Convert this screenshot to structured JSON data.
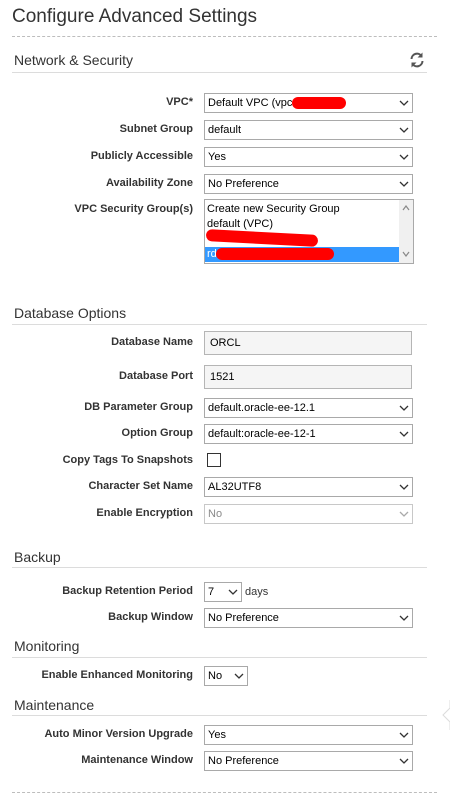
{
  "page": {
    "title": "Configure Advanced Settings"
  },
  "network": {
    "title": "Network & Security",
    "vpc": {
      "label": "VPC*",
      "value": "Default VPC (vpc-"
    },
    "subnet_group": {
      "label": "Subnet Group",
      "value": "default"
    },
    "publicly_accessible": {
      "label": "Publicly Accessible",
      "value": "Yes"
    },
    "availability_zone": {
      "label": "Availability Zone",
      "value": "No Preference"
    },
    "security_groups": {
      "label": "VPC Security Group(s)",
      "options": [
        "Create new Security Group",
        "default (VPC)",
        "",
        "rd"
      ],
      "selected_index": 3
    }
  },
  "database": {
    "title": "Database Options",
    "name": {
      "label": "Database Name",
      "value": "ORCL"
    },
    "port": {
      "label": "Database Port",
      "value": "1521"
    },
    "parameter_group": {
      "label": "DB Parameter Group",
      "value": "default.oracle-ee-12.1"
    },
    "option_group": {
      "label": "Option Group",
      "value": "default:oracle-ee-12-1"
    },
    "copy_tags": {
      "label": "Copy Tags To Snapshots",
      "checked": false
    },
    "character_set": {
      "label": "Character Set Name",
      "value": "AL32UTF8"
    },
    "encryption": {
      "label": "Enable Encryption",
      "value": "No",
      "disabled": true
    }
  },
  "backup": {
    "title": "Backup",
    "retention": {
      "label": "Backup Retention Period",
      "value": "7",
      "suffix": "days"
    },
    "window": {
      "label": "Backup Window",
      "value": "No Preference"
    }
  },
  "monitoring": {
    "title": "Monitoring",
    "enhanced": {
      "label": "Enable Enhanced Monitoring",
      "value": "No"
    }
  },
  "maintenance": {
    "title": "Maintenance",
    "auto_minor": {
      "label": "Auto Minor Version Upgrade",
      "value": "Yes"
    },
    "window": {
      "label": "Maintenance Window",
      "value": "No Preference"
    }
  },
  "icons": {
    "refresh": "refresh-icon",
    "dropdown": "chevron-down-icon"
  },
  "colors": {
    "selection": "#3399ff",
    "redaction": "#ff0000",
    "refresh_icon": "#555555"
  }
}
